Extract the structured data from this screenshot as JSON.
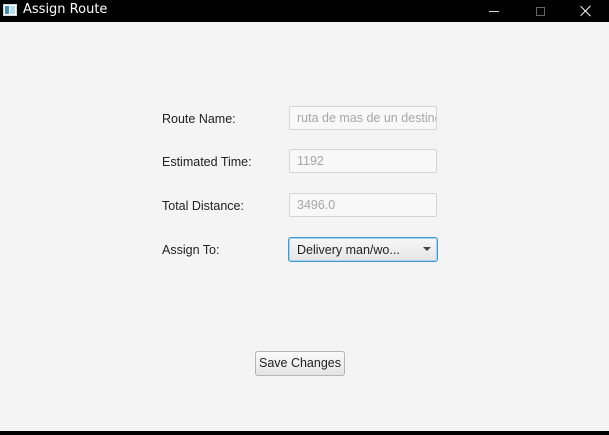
{
  "window": {
    "title": "Assign Route",
    "icon": "app-window-icon",
    "controls": [
      "minimize-icon",
      "maximize-icon",
      "close-icon"
    ]
  },
  "form": {
    "route_name": {
      "label": "Route Name:",
      "value": "ruta de mas de un destino"
    },
    "estimated_time": {
      "label": "Estimated Time:",
      "value": "1192"
    },
    "total_distance": {
      "label": "Total Distance:",
      "value": "3496.0"
    },
    "assign_to": {
      "label": "Assign To:",
      "selected": "Delivery man/wo..."
    }
  },
  "actions": {
    "save_label": "Save Changes"
  },
  "colors": {
    "focus_border": "#3d9ad6",
    "background": "#f4f4f4",
    "titlebar": "#000000"
  }
}
